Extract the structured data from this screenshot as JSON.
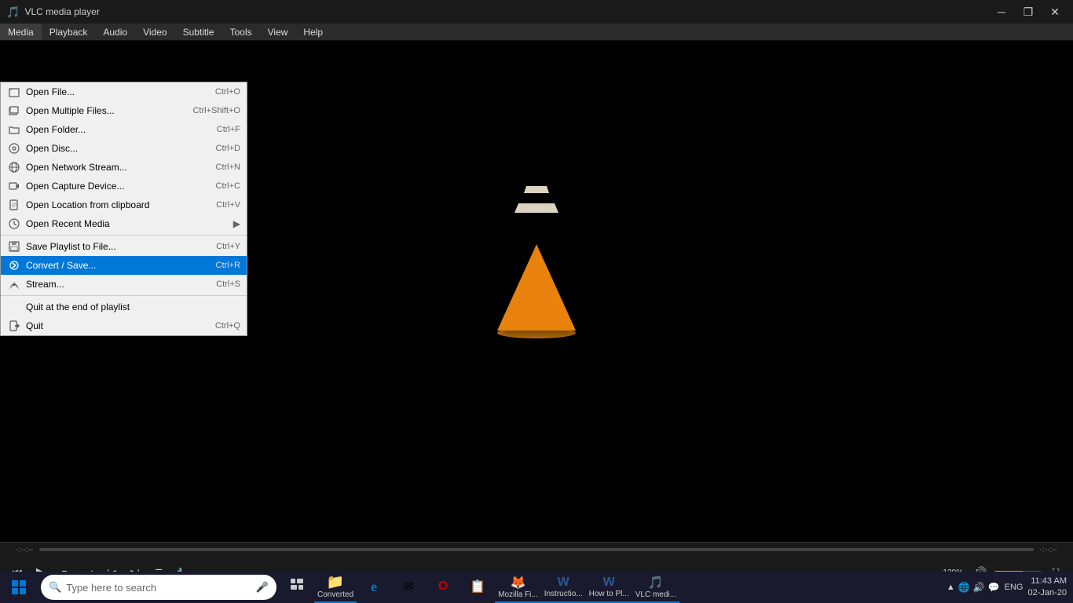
{
  "window": {
    "title": "VLC media player",
    "icon": "🎵"
  },
  "titlebar": {
    "minimize": "─",
    "maximize": "❐",
    "close": "✕"
  },
  "menubar": {
    "items": [
      {
        "id": "media",
        "label": "Media",
        "active": true
      },
      {
        "id": "playback",
        "label": "Playback"
      },
      {
        "id": "audio",
        "label": "Audio"
      },
      {
        "id": "video",
        "label": "Video"
      },
      {
        "id": "subtitle",
        "label": "Subtitle"
      },
      {
        "id": "tools",
        "label": "Tools"
      },
      {
        "id": "view",
        "label": "View"
      },
      {
        "id": "help",
        "label": "Help"
      }
    ]
  },
  "dropdown": {
    "items": [
      {
        "id": "open-file",
        "label": "Open File...",
        "shortcut": "Ctrl+O",
        "icon": "📄",
        "separator_after": false
      },
      {
        "id": "open-multiple",
        "label": "Open Multiple Files...",
        "shortcut": "Ctrl+Shift+O",
        "icon": "📁",
        "separator_after": false
      },
      {
        "id": "open-folder",
        "label": "Open Folder...",
        "shortcut": "Ctrl+F",
        "icon": "📂",
        "separator_after": false
      },
      {
        "id": "open-disc",
        "label": "Open Disc...",
        "shortcut": "Ctrl+D",
        "icon": "💿",
        "separator_after": false
      },
      {
        "id": "open-network",
        "label": "Open Network Stream...",
        "shortcut": "Ctrl+N",
        "icon": "🌐",
        "separator_after": false
      },
      {
        "id": "open-capture",
        "label": "Open Capture Device...",
        "shortcut": "Ctrl+C",
        "icon": "📷",
        "separator_after": false
      },
      {
        "id": "open-location",
        "label": "Open Location from clipboard",
        "shortcut": "Ctrl+V",
        "icon": "📋",
        "separator_after": false
      },
      {
        "id": "open-recent",
        "label": "Open Recent Media",
        "shortcut": "",
        "icon": "🕐",
        "separator_after": true,
        "has_arrow": true
      },
      {
        "id": "save-playlist",
        "label": "Save Playlist to File...",
        "shortcut": "Ctrl+Y",
        "icon": "💾",
        "separator_after": false
      },
      {
        "id": "convert-save",
        "label": "Convert / Save...",
        "shortcut": "Ctrl+R",
        "icon": "🔄",
        "separator_after": false,
        "highlighted": true
      },
      {
        "id": "stream",
        "label": "Stream...",
        "shortcut": "Ctrl+S",
        "icon": "📡",
        "separator_after": true
      },
      {
        "id": "quit-playlist",
        "label": "Quit at the end of playlist",
        "shortcut": "",
        "icon": "",
        "separator_after": false
      },
      {
        "id": "quit",
        "label": "Quit",
        "shortcut": "Ctrl+Q",
        "icon": "🚪",
        "separator_after": false
      }
    ]
  },
  "controls": {
    "seek_left": "-:--:--",
    "seek_right": "-:--:--",
    "volume_pct": "120%",
    "buttons": {
      "prev": "⏮",
      "stop": "⏹",
      "next": "⏭",
      "play": "▶",
      "frame_prev": "⏪",
      "frame_next": "⏩",
      "toggle_playlist": "☰",
      "ext_settings": "⚙",
      "show_ext": "🔧",
      "toggle_controls": "🎛",
      "fullscreen": "⛶",
      "volume_icon": "🔊"
    }
  },
  "taskbar": {
    "search_placeholder": "Type here to search",
    "apps": [
      {
        "id": "taskview",
        "icon": "⊞",
        "label": "",
        "active": false
      },
      {
        "id": "file-explorer",
        "icon": "📁",
        "label": "Converted",
        "active": true
      },
      {
        "id": "edge",
        "icon": "🌐",
        "label": "",
        "active": false
      },
      {
        "id": "mail",
        "icon": "✉",
        "label": "",
        "active": false
      },
      {
        "id": "opera",
        "icon": "O",
        "label": "",
        "active": false
      },
      {
        "id": "notes",
        "icon": "📝",
        "label": "",
        "active": false
      },
      {
        "id": "firefox",
        "icon": "🦊",
        "label": "Mozilla Fi...",
        "active": true
      },
      {
        "id": "word1",
        "icon": "W",
        "label": "Instructio...",
        "active": true
      },
      {
        "id": "word2",
        "icon": "W",
        "label": "How to Pl...",
        "active": true
      },
      {
        "id": "vlc",
        "icon": "🎵",
        "label": "VLC medi...",
        "active": true
      }
    ],
    "tray": {
      "lang": "ENG",
      "time": "11:43 AM",
      "date": "02-Jan-20"
    }
  }
}
